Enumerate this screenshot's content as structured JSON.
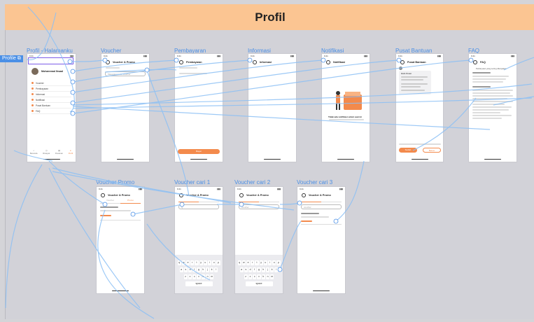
{
  "section_title": "Profil",
  "start_tag": "Profile",
  "frames": {
    "profil": "Profil - Halamanku",
    "voucher": "Voucher",
    "pembayaran": "Pembayaran",
    "informasi": "Informasi",
    "notifikasi": "Notifikasi",
    "pusat": "Pusat Bantuan",
    "faq": "FAQ",
    "voucher_promo": "Voucher Promo",
    "cari1": "Voucher cari 1",
    "cari2": "Voucher cari 2",
    "cari3": "Voucher cari 3"
  },
  "screens": {
    "profil": {
      "user": "Muhammad Ihsaal",
      "menu": [
        "Voucher",
        "Pembayaran",
        "Informasi",
        "Notifikasi",
        "Pusat Bantuan",
        "FAQ"
      ],
      "nav": [
        "Beranda",
        "Riwayat",
        "Pesanan",
        "Profil"
      ]
    },
    "voucher": {
      "title": "Voucher & Promo",
      "search": "Masukkan kode voucher"
    },
    "pembayaran": {
      "title": "Pembayaran",
      "button": "Bayar"
    },
    "informasi": {
      "title": "Informasi"
    },
    "notifikasi": {
      "title": "Notifikasi",
      "empty_title": "Tidak ada notifikasi untuk saat ini"
    },
    "pusat": {
      "title": "Pusat Bantuan",
      "greeting": "Halo Ihsan",
      "yes": "Sudah",
      "no": "Belum"
    },
    "faq": {
      "title": "FAQ",
      "heading": "Pertanyaan yang sering ditanyakan"
    },
    "voucher_promo": {
      "title": "Voucher & Promo",
      "tab1": "Voucher",
      "tab2": "Promo"
    },
    "cari1": {
      "title": "Voucher & Promo",
      "search": "Q"
    },
    "cari2": {
      "title": "Voucher & Promo",
      "search": "voucher"
    },
    "cari3": {
      "title": "Voucher & Promo",
      "search": "voucher"
    }
  },
  "keyboard": {
    "row1": [
      "q",
      "w",
      "e",
      "r",
      "t",
      "y",
      "u",
      "i",
      "o",
      "p"
    ],
    "row2": [
      "a",
      "s",
      "d",
      "f",
      "g",
      "h",
      "j",
      "k",
      "l"
    ],
    "row3": [
      "z",
      "x",
      "c",
      "v",
      "b",
      "n",
      "m"
    ],
    "space": "space"
  }
}
